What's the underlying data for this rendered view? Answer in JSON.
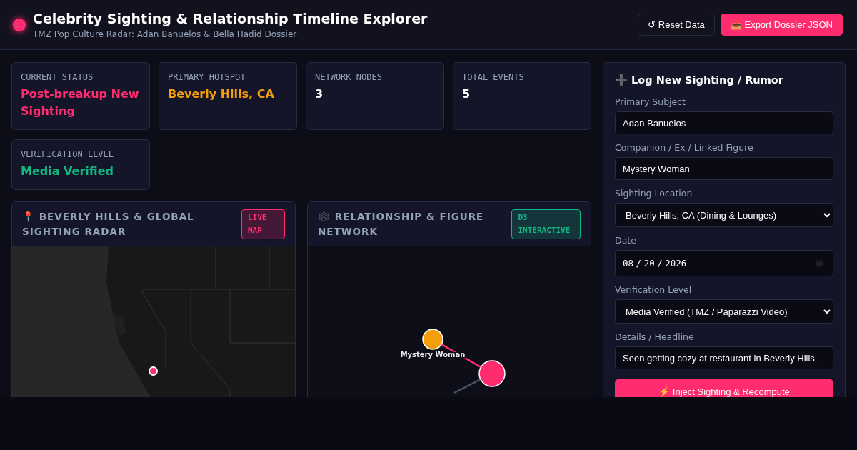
{
  "header": {
    "title": "Celebrity Sighting & Relationship Timeline Explorer",
    "subtitle": "TMZ Pop Culture Radar: Adan Banuelos & Bella Hadid Dossier",
    "buttons": [
      {
        "label": "↺ Reset Data",
        "kind": "secondary"
      },
      {
        "label": "📥 Export Dossier JSON",
        "kind": "primary"
      }
    ]
  },
  "stats": [
    {
      "label": "CURRENT STATUS",
      "value": "Post-breakup New Sighting",
      "color": "#ff2d6f"
    },
    {
      "label": "PRIMARY HOTSPOT",
      "value": "Beverly Hills, CA",
      "color": "#f59e0b"
    },
    {
      "label": "NETWORK NODES",
      "value": "3",
      "color": "#ffffff"
    },
    {
      "label": "TOTAL EVENTS",
      "value": "5",
      "color": "#ffffff"
    },
    {
      "label": "VERIFICATION LEVEL",
      "value": "Media Verified",
      "color": "#10b981"
    }
  ],
  "map_panel": {
    "title": "📍 BEVERLY HILLS & GLOBAL SIGHTING RADAR",
    "badge": {
      "label": "LIVE MAP",
      "color": "#ff2d6f"
    }
  },
  "network_panel": {
    "title": "🕸️ RELATIONSHIP & FIGURE NETWORK",
    "badge": {
      "label": "D3 INTERACTIVE",
      "color": "#10b981"
    },
    "nodes": [
      {
        "label": "Mystery Woman",
        "color": "#f59e0b"
      },
      {
        "color": "#ff2d6f"
      }
    ],
    "links": [
      {
        "color": "#ff2d6f"
      },
      {
        "color": "#475569"
      }
    ]
  },
  "form": {
    "title": "➕ Log New Sighting / Rumor",
    "fields": [
      {
        "label": "Primary Subject",
        "kind": "text",
        "value": "Adan Banuelos"
      },
      {
        "label": "Companion / Ex / Linked Figure",
        "kind": "text",
        "value": "Mystery Woman"
      },
      {
        "label": "Sighting Location",
        "kind": "select",
        "value": "Beverly Hills, CA (Dining & Lounges)"
      },
      {
        "label": "Date",
        "kind": "date",
        "value": "08 / 20 / 2026"
      },
      {
        "label": "Verification Level",
        "kind": "select",
        "value": "Media Verified (TMZ / Paparazzi Video)"
      },
      {
        "label": "Details / Headline",
        "kind": "text",
        "value": "Seen getting cozy at restaurant in Beverly Hills."
      }
    ],
    "submit": "⚡ Inject Sighting & Recompute"
  }
}
